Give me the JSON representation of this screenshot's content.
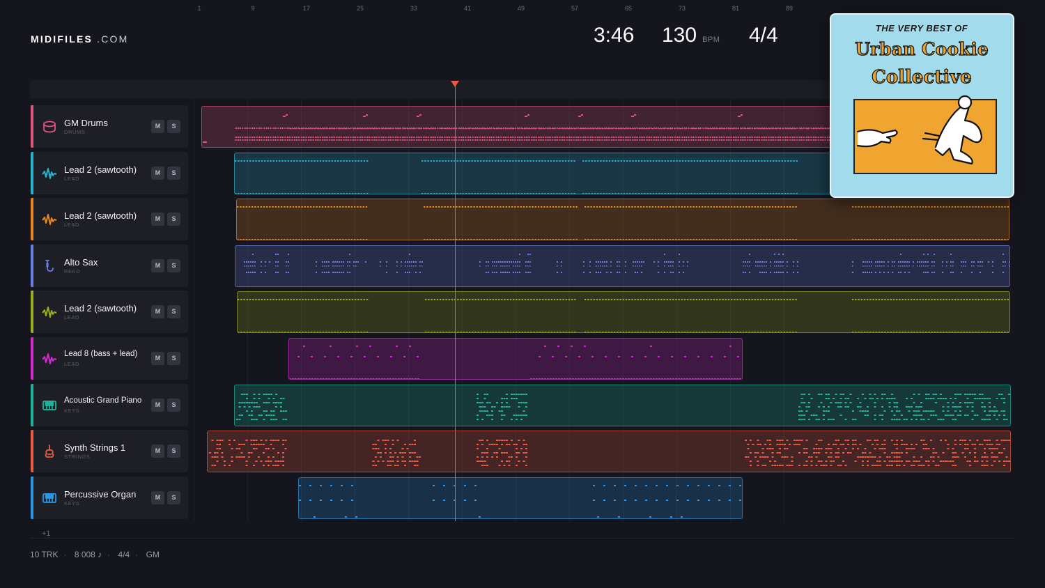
{
  "header": {
    "brand_main": "MIDIFILES",
    "brand_suffix": ".COM",
    "duration": "3:46",
    "tempo": "130",
    "tempo_unit": "BPM",
    "time_signature": "4/4"
  },
  "album": {
    "line1": "THE VERY BEST OF",
    "line2": "Urban Cookie",
    "line3": "Collective"
  },
  "ruler": [
    "1",
    "9",
    "17",
    "25",
    "33",
    "41",
    "49",
    "57",
    "65",
    "73",
    "81",
    "89"
  ],
  "playhead_bar": 41,
  "tracks": [
    {
      "name": "GM Drums",
      "category": "DRUMS",
      "icon": "drum-icon",
      "color": "#e4557e",
      "mute": "M",
      "solo": "S"
    },
    {
      "name": "Lead 2 (sawtooth)",
      "category": "LEAD",
      "icon": "waveform-icon",
      "color": "#27b3d0",
      "mute": "M",
      "solo": "S"
    },
    {
      "name": "Lead 2 (sawtooth)",
      "category": "LEAD",
      "icon": "waveform-icon",
      "color": "#e8871e",
      "mute": "M",
      "solo": "S"
    },
    {
      "name": "Alto Sax",
      "category": "REED",
      "icon": "saxophone-icon",
      "color": "#6b7fe6",
      "mute": "M",
      "solo": "S"
    },
    {
      "name": "Lead 2 (sawtooth)",
      "category": "LEAD",
      "icon": "waveform-icon",
      "color": "#9aae1e",
      "mute": "M",
      "solo": "S"
    },
    {
      "name": "Lead 8 (bass + lead)",
      "category": "LEAD",
      "icon": "waveform-icon",
      "color": "#d52ad0",
      "mute": "M",
      "solo": "S"
    },
    {
      "name": "Acoustic Grand Piano",
      "category": "KEYS",
      "icon": "piano-icon",
      "color": "#1fb59b",
      "mute": "M",
      "solo": "S"
    },
    {
      "name": "Synth Strings 1",
      "category": "STRINGS",
      "icon": "violin-icon",
      "color": "#ee5a42",
      "mute": "M",
      "solo": "S"
    },
    {
      "name": "Percussive Organ",
      "category": "KEYS",
      "icon": "piano-icon",
      "color": "#2a97e4",
      "mute": "M",
      "solo": "S"
    }
  ],
  "more_tracks": "+1",
  "footer": {
    "tracks": "10 TRK",
    "notes": "8 008 ♪",
    "meter": "4/4",
    "standard": "GM"
  },
  "colors": {
    "background": "#15151d",
    "playhead": "#ef5a45"
  }
}
